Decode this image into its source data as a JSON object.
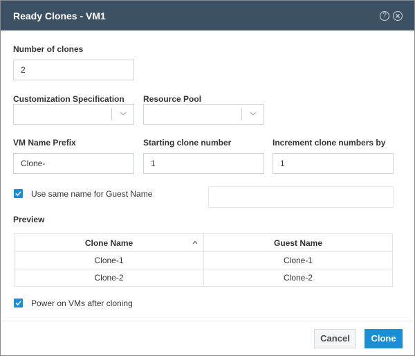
{
  "dialog": {
    "title": "Ready Clones - VM1",
    "help_icon": "help-icon",
    "close_icon": "close-icon"
  },
  "form": {
    "number_of_clones": {
      "label": "Number of clones",
      "value": "2"
    },
    "customization_spec": {
      "label": "Customization Specification",
      "value": ""
    },
    "resource_pool": {
      "label": "Resource Pool",
      "value": ""
    },
    "vm_name_prefix": {
      "label": "VM Name Prefix",
      "value": "Clone-"
    },
    "starting_clone_number": {
      "label": "Starting clone number",
      "value": "1"
    },
    "increment_by": {
      "label": "Increment clone numbers by",
      "value": "1"
    },
    "same_name_checkbox": {
      "label": "Use same name for Guest Name",
      "checked": true
    },
    "guest_name_value": ""
  },
  "preview": {
    "label": "Preview",
    "columns": [
      "Clone Name",
      "Guest Name"
    ],
    "rows": [
      [
        "Clone-1",
        "Clone-1"
      ],
      [
        "Clone-2",
        "Clone-2"
      ]
    ]
  },
  "power_on_checkbox": {
    "label": "Power on VMs after cloning",
    "checked": true
  },
  "buttons": {
    "cancel": "Cancel",
    "clone": "Clone"
  },
  "colors": {
    "header": "#3d5164",
    "accent": "#1a8fd6"
  }
}
